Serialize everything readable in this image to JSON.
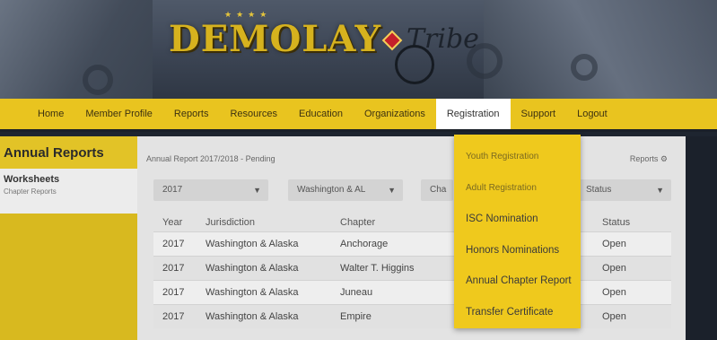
{
  "logo": {
    "word": "DEMOLAY",
    "script": "Tribe",
    "stars": "★★★★"
  },
  "nav": {
    "items": [
      "Home",
      "Member Profile",
      "Reports",
      "Resources",
      "Education",
      "Organizations",
      "Registration",
      "Support",
      "Logout"
    ],
    "active": "Registration"
  },
  "sidebar": {
    "heading": "Annual Reports",
    "sub_title": "Worksheets",
    "sub_caption": "Chapter Reports"
  },
  "main": {
    "breadcrumb": "Annual Report 2017/2018 - Pending",
    "reports_link": "Reports ⚙",
    "filters": {
      "year": "2017",
      "jurisdiction": "Washington & AL",
      "chapter": "Cha",
      "status": "Status"
    },
    "table": {
      "headers": [
        "Year",
        "Jurisdiction",
        "Chapter",
        "",
        "Status"
      ],
      "rows": [
        [
          "2017",
          "Washington & Alaska",
          "Anchorage",
          "",
          "Open"
        ],
        [
          "2017",
          "Washington & Alaska",
          "Walter T. Higgins",
          "",
          "Open"
        ],
        [
          "2017",
          "Washington & Alaska",
          "Juneau",
          "",
          "Open"
        ],
        [
          "2017",
          "Washington & Alaska",
          "Empire",
          "",
          "Open"
        ]
      ]
    }
  },
  "dropdown": {
    "items": [
      "Youth Registration",
      "Adult Registration",
      "ISC Nomination",
      "Honors Nominations",
      "Annual Chapter Report",
      "Transfer Certificate"
    ]
  },
  "colors": {
    "accent": "#e9c41f",
    "banner": "#3c4554",
    "content": "#e3e3e3"
  }
}
